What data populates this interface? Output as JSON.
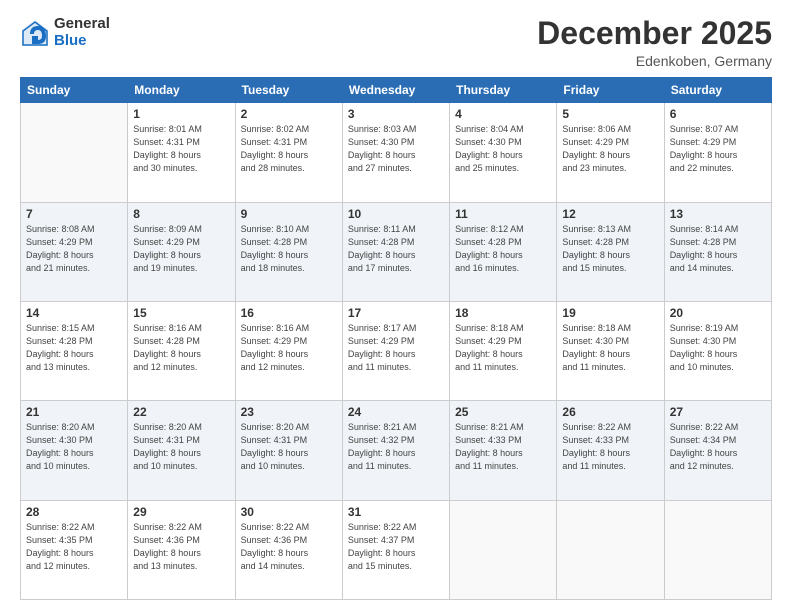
{
  "header": {
    "logo_general": "General",
    "logo_blue": "Blue",
    "title": "December 2025",
    "subtitle": "Edenkoben, Germany"
  },
  "weekdays": [
    "Sunday",
    "Monday",
    "Tuesday",
    "Wednesday",
    "Thursday",
    "Friday",
    "Saturday"
  ],
  "weeks": [
    [
      {
        "day": "",
        "info": ""
      },
      {
        "day": "1",
        "info": "Sunrise: 8:01 AM\nSunset: 4:31 PM\nDaylight: 8 hours\nand 30 minutes."
      },
      {
        "day": "2",
        "info": "Sunrise: 8:02 AM\nSunset: 4:31 PM\nDaylight: 8 hours\nand 28 minutes."
      },
      {
        "day": "3",
        "info": "Sunrise: 8:03 AM\nSunset: 4:30 PM\nDaylight: 8 hours\nand 27 minutes."
      },
      {
        "day": "4",
        "info": "Sunrise: 8:04 AM\nSunset: 4:30 PM\nDaylight: 8 hours\nand 25 minutes."
      },
      {
        "day": "5",
        "info": "Sunrise: 8:06 AM\nSunset: 4:29 PM\nDaylight: 8 hours\nand 23 minutes."
      },
      {
        "day": "6",
        "info": "Sunrise: 8:07 AM\nSunset: 4:29 PM\nDaylight: 8 hours\nand 22 minutes."
      }
    ],
    [
      {
        "day": "7",
        "info": "Sunrise: 8:08 AM\nSunset: 4:29 PM\nDaylight: 8 hours\nand 21 minutes."
      },
      {
        "day": "8",
        "info": "Sunrise: 8:09 AM\nSunset: 4:29 PM\nDaylight: 8 hours\nand 19 minutes."
      },
      {
        "day": "9",
        "info": "Sunrise: 8:10 AM\nSunset: 4:28 PM\nDaylight: 8 hours\nand 18 minutes."
      },
      {
        "day": "10",
        "info": "Sunrise: 8:11 AM\nSunset: 4:28 PM\nDaylight: 8 hours\nand 17 minutes."
      },
      {
        "day": "11",
        "info": "Sunrise: 8:12 AM\nSunset: 4:28 PM\nDaylight: 8 hours\nand 16 minutes."
      },
      {
        "day": "12",
        "info": "Sunrise: 8:13 AM\nSunset: 4:28 PM\nDaylight: 8 hours\nand 15 minutes."
      },
      {
        "day": "13",
        "info": "Sunrise: 8:14 AM\nSunset: 4:28 PM\nDaylight: 8 hours\nand 14 minutes."
      }
    ],
    [
      {
        "day": "14",
        "info": "Sunrise: 8:15 AM\nSunset: 4:28 PM\nDaylight: 8 hours\nand 13 minutes."
      },
      {
        "day": "15",
        "info": "Sunrise: 8:16 AM\nSunset: 4:28 PM\nDaylight: 8 hours\nand 12 minutes."
      },
      {
        "day": "16",
        "info": "Sunrise: 8:16 AM\nSunset: 4:29 PM\nDaylight: 8 hours\nand 12 minutes."
      },
      {
        "day": "17",
        "info": "Sunrise: 8:17 AM\nSunset: 4:29 PM\nDaylight: 8 hours\nand 11 minutes."
      },
      {
        "day": "18",
        "info": "Sunrise: 8:18 AM\nSunset: 4:29 PM\nDaylight: 8 hours\nand 11 minutes."
      },
      {
        "day": "19",
        "info": "Sunrise: 8:18 AM\nSunset: 4:30 PM\nDaylight: 8 hours\nand 11 minutes."
      },
      {
        "day": "20",
        "info": "Sunrise: 8:19 AM\nSunset: 4:30 PM\nDaylight: 8 hours\nand 10 minutes."
      }
    ],
    [
      {
        "day": "21",
        "info": "Sunrise: 8:20 AM\nSunset: 4:30 PM\nDaylight: 8 hours\nand 10 minutes."
      },
      {
        "day": "22",
        "info": "Sunrise: 8:20 AM\nSunset: 4:31 PM\nDaylight: 8 hours\nand 10 minutes."
      },
      {
        "day": "23",
        "info": "Sunrise: 8:20 AM\nSunset: 4:31 PM\nDaylight: 8 hours\nand 10 minutes."
      },
      {
        "day": "24",
        "info": "Sunrise: 8:21 AM\nSunset: 4:32 PM\nDaylight: 8 hours\nand 11 minutes."
      },
      {
        "day": "25",
        "info": "Sunrise: 8:21 AM\nSunset: 4:33 PM\nDaylight: 8 hours\nand 11 minutes."
      },
      {
        "day": "26",
        "info": "Sunrise: 8:22 AM\nSunset: 4:33 PM\nDaylight: 8 hours\nand 11 minutes."
      },
      {
        "day": "27",
        "info": "Sunrise: 8:22 AM\nSunset: 4:34 PM\nDaylight: 8 hours\nand 12 minutes."
      }
    ],
    [
      {
        "day": "28",
        "info": "Sunrise: 8:22 AM\nSunset: 4:35 PM\nDaylight: 8 hours\nand 12 minutes."
      },
      {
        "day": "29",
        "info": "Sunrise: 8:22 AM\nSunset: 4:36 PM\nDaylight: 8 hours\nand 13 minutes."
      },
      {
        "day": "30",
        "info": "Sunrise: 8:22 AM\nSunset: 4:36 PM\nDaylight: 8 hours\nand 14 minutes."
      },
      {
        "day": "31",
        "info": "Sunrise: 8:22 AM\nSunset: 4:37 PM\nDaylight: 8 hours\nand 15 minutes."
      },
      {
        "day": "",
        "info": ""
      },
      {
        "day": "",
        "info": ""
      },
      {
        "day": "",
        "info": ""
      }
    ]
  ]
}
